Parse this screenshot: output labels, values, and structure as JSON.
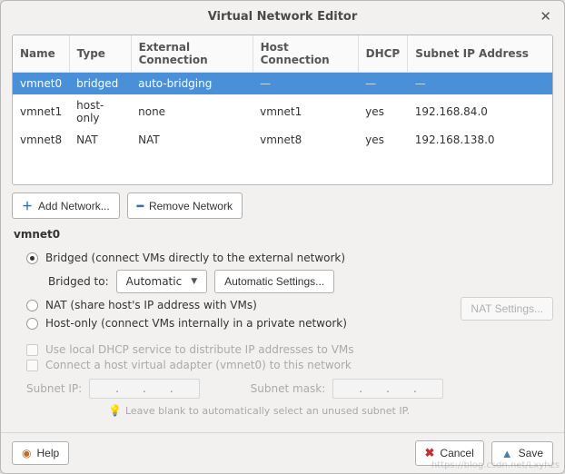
{
  "window": {
    "title": "Virtual Network Editor"
  },
  "table": {
    "headers": {
      "name": "Name",
      "type": "Type",
      "ext": "External Connection",
      "host": "Host Connection",
      "dhcp": "DHCP",
      "subnet": "Subnet IP Address"
    },
    "rows": [
      {
        "name": "vmnet0",
        "type": "bridged",
        "ext": "auto-bridging",
        "host": "—",
        "dhcp": "—",
        "subnet": "—",
        "selected": true
      },
      {
        "name": "vmnet1",
        "type": "host-only",
        "ext": "none",
        "host": "vmnet1",
        "dhcp": "yes",
        "subnet": "192.168.84.0"
      },
      {
        "name": "vmnet8",
        "type": "NAT",
        "ext": "NAT",
        "host": "vmnet8",
        "dhcp": "yes",
        "subnet": "192.168.138.0"
      }
    ]
  },
  "buttons": {
    "add": "Add Network...",
    "remove": "Remove Network",
    "auto_settings": "Automatic Settings...",
    "nat_settings": "NAT Settings...",
    "help": "Help",
    "cancel": "Cancel",
    "save": "Save"
  },
  "config": {
    "selected_name": "vmnet0",
    "bridged_label": "Bridged (connect VMs directly to the external network)",
    "bridged_to_label": "Bridged to:",
    "bridged_to_value": "Automatic",
    "nat_label": "NAT (share host's IP address with VMs)",
    "host_only_label": "Host-only (connect VMs internally in a private network)",
    "dhcp_label": "Use local DHCP service to distribute IP addresses to VMs",
    "host_adapter_label": "Connect a host virtual adapter (vmnet0) to this network",
    "subnet_ip_label": "Subnet IP:",
    "subnet_mask_label": "Subnet mask:",
    "hint": "Leave blank to automatically select an unused subnet IP."
  }
}
